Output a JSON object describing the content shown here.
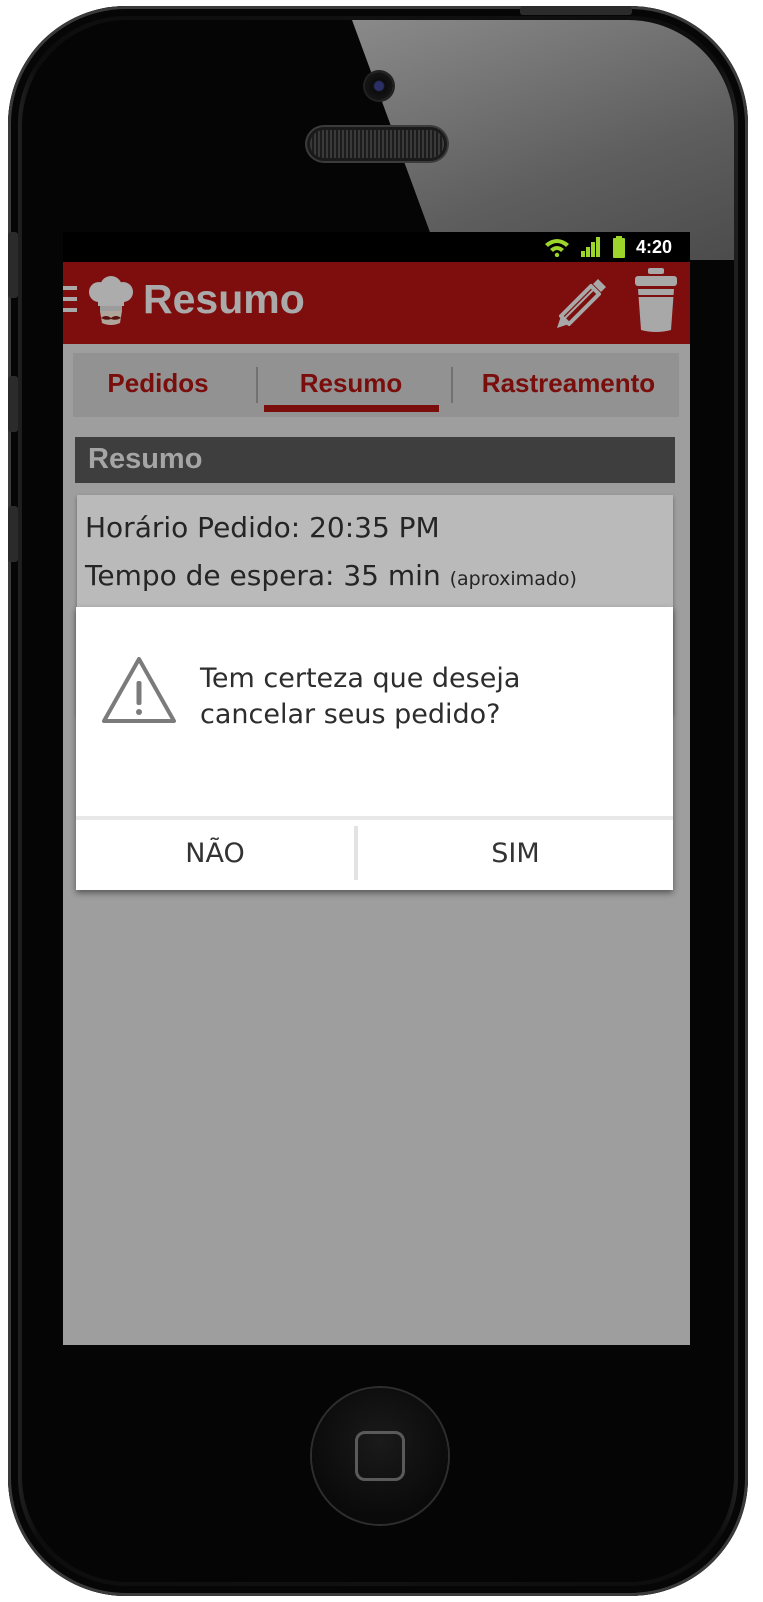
{
  "status_bar": {
    "time": "4:20",
    "icons": [
      "wifi-icon",
      "signal-icon",
      "battery-icon"
    ]
  },
  "app_bar": {
    "title": "Resumo",
    "icons": [
      "drawer-icon",
      "chef-hat-logo",
      "pencil-icon",
      "trash-icon"
    ]
  },
  "tabs": [
    {
      "label": "Pedidos",
      "selected": false
    },
    {
      "label": "Resumo",
      "selected": true
    },
    {
      "label": "Rastreamento",
      "selected": false
    }
  ],
  "section": {
    "title": "Resumo"
  },
  "summary": {
    "order_time": "Horário Pedido: 20:35 PM",
    "wait_time": "Tempo de espera: 35 min",
    "wait_note": "(aproximado)"
  },
  "dialog": {
    "icon": "warning-icon",
    "message": "Tem certeza que deseja cancelar seus pedido?",
    "negative_label": "NÃO",
    "positive_label": "SIM"
  },
  "colors": {
    "brand_red": "#ad1412",
    "tab_text": "#a61411",
    "section_header": "#555555"
  }
}
